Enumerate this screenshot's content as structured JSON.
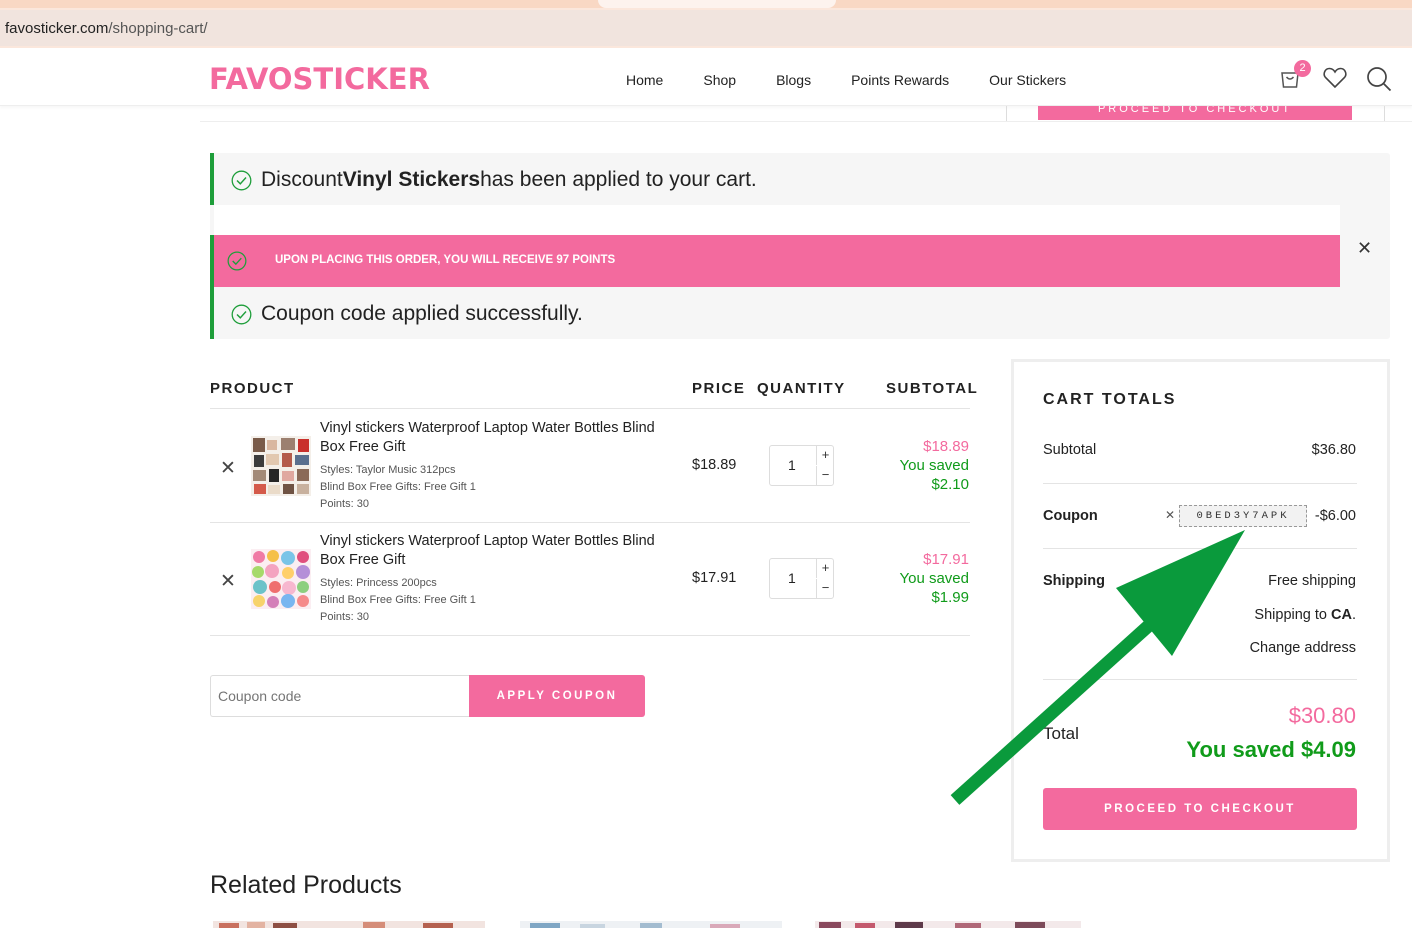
{
  "browser": {
    "url_domain": "favosticker.com",
    "url_path": "/shopping-cart/"
  },
  "header": {
    "logo": "FAVOSTICKER",
    "nav": [
      "Home",
      "Shop",
      "Blogs",
      "Points Rewards",
      "Our Stickers"
    ],
    "cart_count": "2",
    "sticky_button": "PROCEED TO CHECKOUT"
  },
  "notices": {
    "discount_prefix": "Discount",
    "discount_name": "Vinyl Stickers",
    "discount_suffix": "has been applied to your cart.",
    "points": "UPON PLACING THIS ORDER, YOU WILL RECEIVE 97 POINTS",
    "coupon_applied": "Coupon code applied successfully."
  },
  "table": {
    "headers": {
      "product": "PRODUCT",
      "price": "PRICE",
      "quantity": "QUANTITY",
      "subtotal": "SUBTOTAL"
    },
    "items": [
      {
        "title": "Vinyl stickers Waterproof Laptop Water Bottles Blind Box Free Gift",
        "style_label": "Styles:",
        "style_value": "Taylor Music 312pcs",
        "gift_label": "Blind Box Free Gifts:",
        "gift_value": "Free Gift 1",
        "points_label": "Points:",
        "points_value": "30",
        "price": "$18.89",
        "qty": "1",
        "subtotal": "$18.89",
        "saved_label": "You saved",
        "saved": "$2.10"
      },
      {
        "title": "Vinyl stickers Waterproof Laptop Water Bottles Blind Box Free Gift",
        "style_label": "Styles:",
        "style_value": "Princess 200pcs",
        "gift_label": "Blind Box Free Gifts:",
        "gift_value": "Free Gift 1",
        "points_label": "Points:",
        "points_value": "30",
        "price": "$17.91",
        "qty": "1",
        "subtotal": "$17.91",
        "saved_label": "You saved",
        "saved": "$1.99"
      }
    ]
  },
  "coupon": {
    "placeholder": "Coupon code",
    "apply": "APPLY COUPON"
  },
  "totals": {
    "title": "CART TOTALS",
    "subtotal_label": "Subtotal",
    "subtotal": "$36.80",
    "coupon_label": "Coupon",
    "coupon_code": "0BED3Y7APK",
    "coupon_amount": "-$6.00",
    "shipping_label": "Shipping",
    "shipping_value": "Free shipping",
    "shipping_to_prefix": "Shipping to ",
    "shipping_to_region": "CA",
    "shipping_to_suffix": ".",
    "change_address": "Change address",
    "total_label": "Total",
    "total": "$30.80",
    "total_saved": "You saved $4.09",
    "checkout": "PROCEED TO CHECKOUT"
  },
  "related": {
    "title": "Related Products"
  },
  "colors": {
    "brand_pink": "#f36a9e",
    "success_green": "#109b1a",
    "notice_green": "#1e9e3a",
    "arrow_green": "#0a9a3c"
  }
}
